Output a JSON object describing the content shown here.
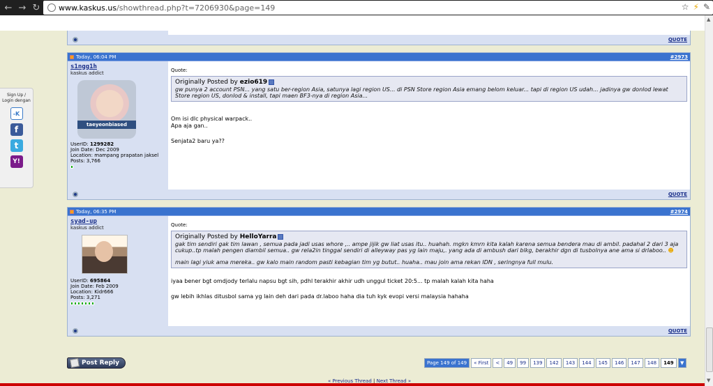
{
  "browser": {
    "url_host": "www.kaskus.us",
    "url_path": "/showthread.php?t=7206930&page=149"
  },
  "share": {
    "label_line1": "Sign Up /",
    "label_line2": "Login dengan",
    "kaskus_glyph": "-K"
  },
  "post_top": {
    "quote_label": "QUOTE"
  },
  "posts": [
    {
      "date": "Today, 06:04 PM",
      "number": "#2973",
      "username": "s1ngg1h",
      "user_title": "kaskus addict",
      "avatar_caption": "taeyeonbiased",
      "userid_label": "UserID:",
      "userid": "1299282",
      "join_date": "Join Date: Dec 2009",
      "location": "Location: mampang prapatan jaksel",
      "posts": "Posts: 3,766",
      "reputation_count": 1,
      "quote_header": "Quote:",
      "quote_by_prefix": "Originally Posted by",
      "quote_author": "ezio619",
      "quote_text": "gw punya 2 account PSN... yang satu ber-region Asia, satunya lagi region US... di PSN Store region Asia emang belom keluar... tapi di region US udah... jadinya gw donlod lewat Store region US, donlod & install, tapi maen BF3-nya di region Asia...",
      "body_line1": "Om isi dlc physical warpack..",
      "body_line2": "Apa aja gan..",
      "body_line3": "Senjata2 baru ya??",
      "quote_label": "QUOTE"
    },
    {
      "date": "Today, 06:35 PM",
      "number": "#2974",
      "username": "syad-up",
      "user_title": "kaskus addict",
      "userid_label": "UserID:",
      "userid": "695864",
      "join_date": "Join Date: Feb 2009",
      "location": "Location: Kidr666",
      "posts": "Posts: 3,271",
      "reputation_count": 7,
      "quote_header": "Quote:",
      "quote_by_prefix": "Originally Posted by",
      "quote_author": "HelloYarra",
      "quote_text": "gak tim sendiri gak tim lawan , semua pada jadi usas whore ,.. ampe jijik gw liat usas itu.. huahah. mgkn kmrn kita kalah karena semua bendera mau di ambil. padahal 2 dari 3 aja cukup..tp malah pengen diambil semua.. gw rela2in tinggal sendiri di alleyway pas yg lain maju,. yang ada di ambush dari blkg, berakhir dgn di tusbolnya ane ama si drlaboo..",
      "quote_text2": "main lagi yiuk ama mereka.. gw kalo main random pasti kebagian tim yg butut.. huaha.. mau join ama rekan IDN , seringnya full mulu.",
      "body_line1": "iyaa bener bgt omdjody terlalu napsu bgt sih, pdhl terakhir akhir udh unggul ticket 20:5... tp malah kalah kita haha",
      "body_line2": "gw lebih ikhlas ditusbol sama yg lain deh dari pada dr.laboo haha dia tuh kyk evopi versi malaysia hahaha",
      "quote_label": "QUOTE"
    }
  ],
  "footer": {
    "reply_label": "Post Reply",
    "page_info": "Page 149 of 149",
    "first_label": "« First",
    "prev_label": "<",
    "pages": [
      "49",
      "99",
      "139",
      "142",
      "143",
      "144",
      "145",
      "146",
      "147",
      "148"
    ],
    "current_page": "149",
    "prev_thread": "« Previous Thread",
    "separator": "|",
    "next_thread": "Next Thread »"
  },
  "colors": {
    "post_header": "#3a73cf",
    "user_column": "#d8e0f2",
    "page_bg": "#ececd4"
  }
}
